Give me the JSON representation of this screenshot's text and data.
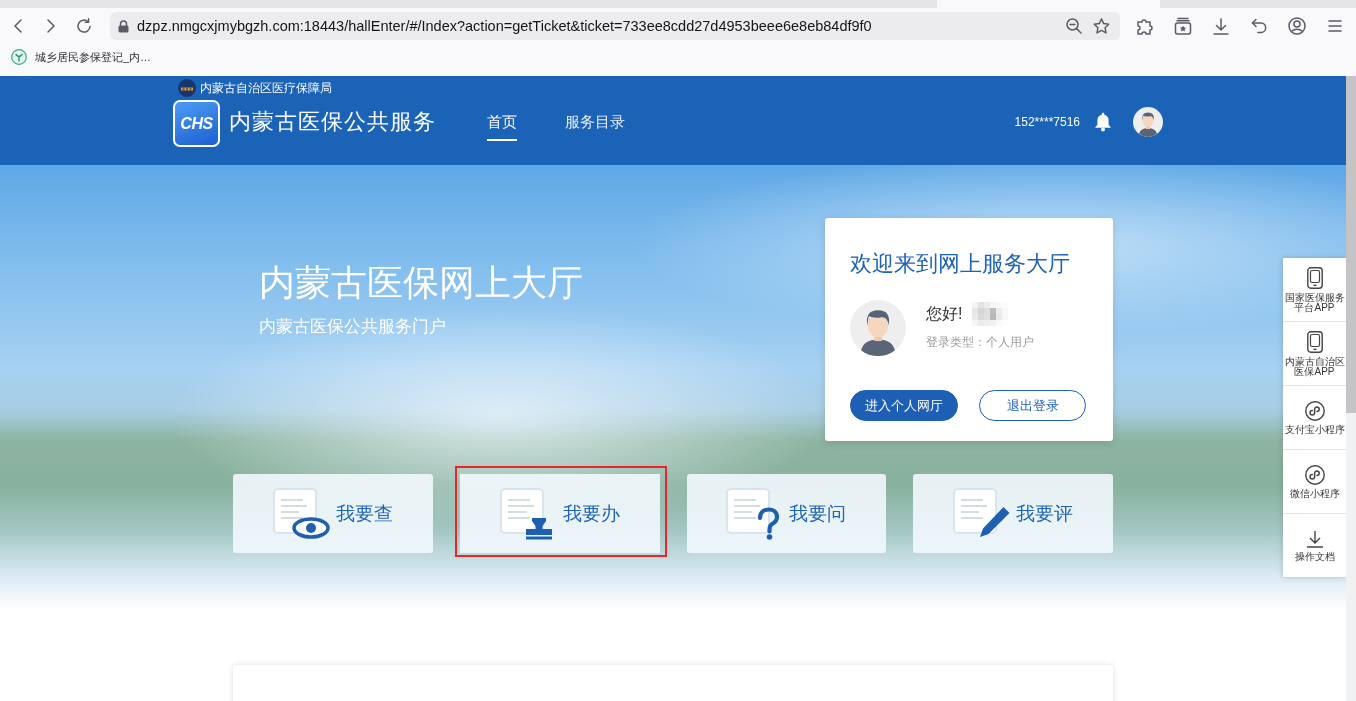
{
  "browser": {
    "url": "dzpz.nmgcxjmybgzh.com:18443/hallEnter/#/Index?action=getTicket&ticket=733ee8cdd27d4953beee6e8eb84df9f0",
    "bookmarks": [
      {
        "label": "城乡居民参保登记_内…"
      }
    ]
  },
  "header": {
    "agency": "内蒙古自治区医疗保障局",
    "logo_text": "CHS",
    "title": "内蒙古医保公共服务",
    "nav": [
      {
        "label": "首页",
        "selected": true
      },
      {
        "label": "服务目录",
        "selected": false
      }
    ],
    "phone": "152****7516"
  },
  "hero": {
    "title": "内蒙古医保网上大厅",
    "subtitle": "内蒙古医保公共服务门户"
  },
  "welcome": {
    "title": "欢迎来到网上服务大厅",
    "greeting": "您好!",
    "login_type": "登录类型：个人用户",
    "buttons": [
      {
        "label": "进入个人网厅",
        "kind": "primary"
      },
      {
        "label": "退出登录",
        "kind": "outline"
      }
    ]
  },
  "services": [
    {
      "label": "我要查",
      "kind": "query",
      "highlighted": false
    },
    {
      "label": "我要办",
      "kind": "handle",
      "highlighted": true
    },
    {
      "label": "我要问",
      "kind": "ask",
      "highlighted": false
    },
    {
      "label": "我要评",
      "kind": "review",
      "highlighted": false
    }
  ],
  "side_tools": [
    {
      "label": "国家医保服务平台APP",
      "kind": "app"
    },
    {
      "label": "内蒙古自治区医保APP",
      "kind": "app"
    },
    {
      "label": "支付宝小程序",
      "kind": "miniprogram"
    },
    {
      "label": "微信小程序",
      "kind": "miniprogram"
    },
    {
      "label": "操作文档",
      "kind": "download"
    }
  ]
}
